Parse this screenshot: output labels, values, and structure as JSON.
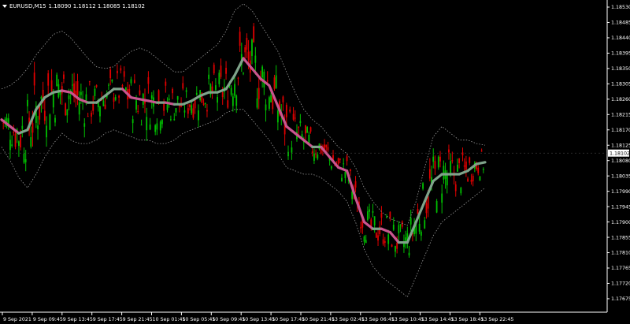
{
  "header": {
    "symbol": "EURUSD,M15",
    "ohlc": "1.18090 1.18112 1.18085 1.18102"
  },
  "colors": {
    "background": "#000000",
    "bull_candle": "#00c000",
    "bear_candle": "#e00000",
    "ma_up": "#7fa38a",
    "ma_down": "#c9558f",
    "band": "#9a9a9a",
    "axis": "#ffffff"
  },
  "current_price_label": "1.18102",
  "chart_data": {
    "type": "line",
    "title": "EURUSD,M15",
    "price_axis": {
      "ticks": [
        "1.18530",
        "1.18485",
        "1.18440",
        "1.18395",
        "1.18350",
        "1.18305",
        "1.18260",
        "1.18215",
        "1.18170",
        "1.18125",
        "1.18080",
        "1.18035",
        "1.17990",
        "1.17945",
        "1.17900",
        "1.17855",
        "1.17810",
        "1.17765",
        "1.17720",
        "1.17675"
      ],
      "ylim": [
        1.17675,
        1.1855
      ]
    },
    "time_axis": {
      "ticks": [
        "9 Sep 2021",
        "9 Sep 09:45",
        "9 Sep 13:45",
        "9 Sep 17:45",
        "9 Sep 21:45",
        "10 Sep 01:45",
        "10 Sep 05:45",
        "10 Sep 09:45",
        "10 Sep 13:45",
        "10 Sep 17:45",
        "10 Sep 21:45",
        "13 Sep 02:45",
        "13 Sep 06:45",
        "13 Sep 10:45",
        "13 Sep 14:45",
        "13 Sep 18:45",
        "13 Sep 22:45"
      ]
    },
    "grid": false,
    "series": [
      {
        "kind": "moving-average",
        "values": [
          1.182,
          1.1818,
          1.1816,
          1.1817,
          1.1823,
          1.18265,
          1.1828,
          1.18285,
          1.1828,
          1.1826,
          1.1825,
          1.1825,
          1.1827,
          1.1829,
          1.1829,
          1.18265,
          1.1826,
          1.18255,
          1.1825,
          1.1825,
          1.18245,
          1.18245,
          1.18255,
          1.1827,
          1.1828,
          1.1828,
          1.1829,
          1.1833,
          1.1838,
          1.1835,
          1.1832,
          1.183,
          1.1824,
          1.1818,
          1.1816,
          1.1814,
          1.1812,
          1.1812,
          1.1809,
          1.1806,
          1.1805,
          1.1797,
          1.179,
          1.1788,
          1.1788,
          1.1787,
          1.1784,
          1.1784,
          1.179,
          1.1796,
          1.1802,
          1.1804,
          1.1804,
          1.1804,
          1.1805,
          1.1807,
          1.18075
        ]
      },
      {
        "kind": "upper-band",
        "values": [
          1.1829,
          1.183,
          1.1832,
          1.1835,
          1.1839,
          1.1842,
          1.1845,
          1.1846,
          1.1844,
          1.1841,
          1.1838,
          1.18355,
          1.1835,
          1.18355,
          1.1838,
          1.184,
          1.1841,
          1.184,
          1.1838,
          1.1836,
          1.1834,
          1.1834,
          1.1836,
          1.1838,
          1.184,
          1.1842,
          1.1846,
          1.1852,
          1.1854,
          1.1852,
          1.1848,
          1.1844,
          1.184,
          1.1834,
          1.1828,
          1.1823,
          1.182,
          1.1818,
          1.1815,
          1.1812,
          1.181,
          1.1806,
          1.18,
          1.1796,
          1.1793,
          1.1791,
          1.179,
          1.1789,
          1.1796,
          1.1806,
          1.1815,
          1.1818,
          1.1816,
          1.1814,
          1.1814,
          1.1813,
          1.18125
        ]
      },
      {
        "kind": "lower-band",
        "values": [
          1.1812,
          1.1808,
          1.1803,
          1.18,
          1.1804,
          1.1809,
          1.1813,
          1.1816,
          1.1814,
          1.1813,
          1.1813,
          1.1814,
          1.1816,
          1.1817,
          1.1816,
          1.1815,
          1.1814,
          1.1814,
          1.1813,
          1.1813,
          1.1814,
          1.1816,
          1.1817,
          1.1818,
          1.1819,
          1.182,
          1.1822,
          1.1823,
          1.1823,
          1.182,
          1.1817,
          1.1814,
          1.181,
          1.1806,
          1.1805,
          1.1804,
          1.1804,
          1.1803,
          1.1801,
          1.1799,
          1.1796,
          1.179,
          1.1782,
          1.1777,
          1.1774,
          1.1772,
          1.177,
          1.1768,
          1.1774,
          1.178,
          1.1786,
          1.179,
          1.1792,
          1.1794,
          1.1796,
          1.1798,
          1.18
        ]
      }
    ]
  }
}
